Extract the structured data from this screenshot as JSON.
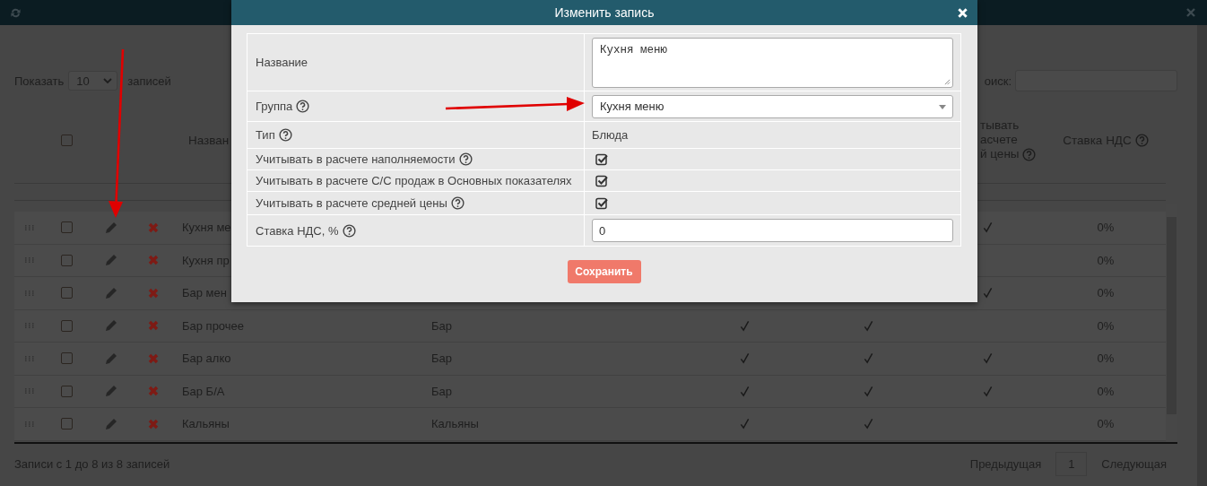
{
  "length_control": {
    "label_before": "Показать",
    "value": "10",
    "label_after": "записей"
  },
  "search": {
    "label": "оиск:"
  },
  "table": {
    "select_all_checked": false,
    "name_header": "Назван",
    "avg_header": [
      "тывать",
      "асчете",
      "й цены"
    ],
    "avg_header_help": true,
    "vat_header": "Ставка НДС",
    "vat_header_help": true,
    "rows": [
      {
        "name": "Кухня ме",
        "checked": false,
        "avg": true,
        "vat": "0%"
      },
      {
        "name": "Кухня пр",
        "checked": false,
        "avg": false,
        "vat": "0%"
      },
      {
        "name": "Бар мен",
        "checked": false,
        "avg": true,
        "vat": "0%"
      },
      {
        "name": "Бар прочее",
        "checked": false,
        "group": "Бар",
        "fill": true,
        "cost": true,
        "avg": false,
        "vat": "0%"
      },
      {
        "name": "Бар алко",
        "checked": false,
        "group": "Бар",
        "fill": true,
        "cost": true,
        "avg": true,
        "vat": "0%"
      },
      {
        "name": "Бар Б/А",
        "checked": false,
        "group": "Бар",
        "fill": true,
        "cost": true,
        "avg": true,
        "vat": "0%"
      },
      {
        "name": "Кальяны",
        "checked": false,
        "group": "Кальяны",
        "fill": true,
        "cost": true,
        "avg": false,
        "vat": "0%"
      }
    ]
  },
  "footer": {
    "info": "Записи с 1 до 8 из 8 записей",
    "prev": "Предыдущая",
    "page": "1",
    "next": "Следующая"
  },
  "modal": {
    "title": "Изменить запись",
    "save": "Сохранить",
    "fields": [
      {
        "label": "Название",
        "help": false,
        "kind": "textarea",
        "value": "Кухня меню"
      },
      {
        "label": "Группа",
        "help": true,
        "kind": "select",
        "value": "Кухня меню"
      },
      {
        "label": "Тип",
        "help": true,
        "kind": "text",
        "value": "Блюда"
      },
      {
        "label": "Учитывать в расчете наполняемости",
        "help": true,
        "kind": "checkbox",
        "checked": true
      },
      {
        "label": "Учитывать в расчете С/С продаж в Основных показателях",
        "help": false,
        "kind": "checkbox",
        "checked": true
      },
      {
        "label": "Учитывать в расчете средней цены",
        "help": true,
        "kind": "checkbox",
        "checked": true
      },
      {
        "label": "Ставка НДС, %",
        "help": true,
        "kind": "input",
        "value": "0"
      }
    ]
  }
}
